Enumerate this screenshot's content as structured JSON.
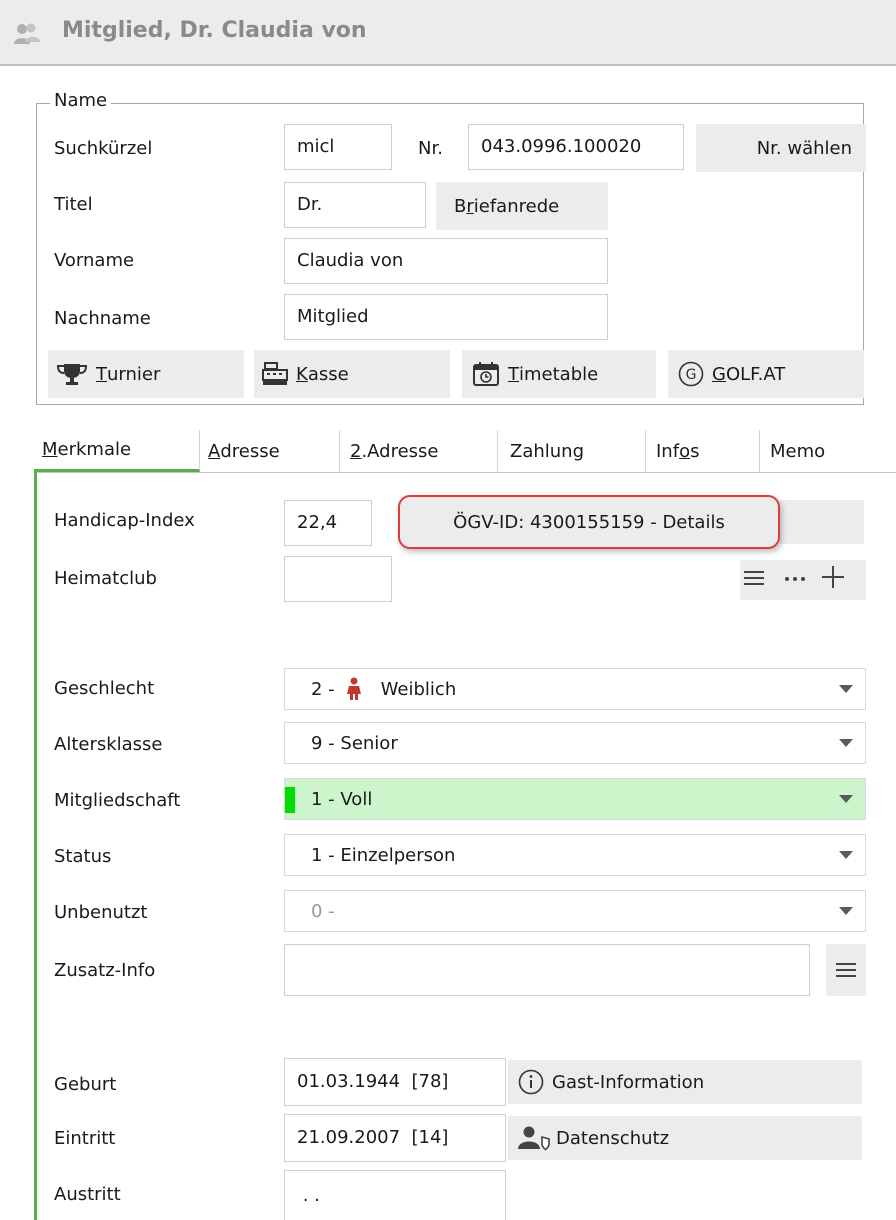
{
  "window": {
    "title": "Mitglied, Dr. Claudia von"
  },
  "name_group": {
    "legend": "Name",
    "suchkuerzel_label": "Suchkürzel",
    "suchkuerzel_value": "micl",
    "nr_label": "Nr.",
    "nr_value": "043.0996.100020",
    "nr_waehlen": "Nr. wählen",
    "titel_label": "Titel",
    "titel_value": "Dr.",
    "briefanrede_prefix": "B",
    "briefanrede_u": "r",
    "briefanrede_suffix": "iefanrede",
    "vorname_label": "Vorname",
    "vorname_value": "Claudia von",
    "nachname_label": "Nachname",
    "nachname_value": "Mitglied"
  },
  "toolbar": {
    "turnier_u": "T",
    "turnier_rest": "urnier",
    "kasse_u": "K",
    "kasse_rest": "asse",
    "timetable_u": "T",
    "timetable_rest": "imetable",
    "golf_u": "G",
    "golf_rest": "OLF.AT"
  },
  "tabs": {
    "merkmale_u": "M",
    "merkmale_rest": "erkmale",
    "adresse_u": "A",
    "adresse_rest": "dresse",
    "adresse2_u": "2",
    "adresse2_rest": ".Adresse",
    "zahlung": "Zahlung",
    "infos_pre": "Inf",
    "infos_u": "o",
    "infos_rest": "s",
    "memo": "Memo"
  },
  "merkmale": {
    "handicap_label": "Handicap-Index",
    "handicap_value": "22,4",
    "ogv_button": "ÖGV-ID: 4300155159 - Details",
    "heimatclub_label": "Heimatclub",
    "heimatclub_value": "",
    "geschlecht_label": "Geschlecht",
    "geschlecht_code": "2 -",
    "geschlecht_value": "Weiblich",
    "altersklasse_label": "Altersklasse",
    "altersklasse_value": "9 - Senior",
    "mitgliedschaft_label": "Mitgliedschaft",
    "mitgliedschaft_value": "1 - Voll",
    "status_label": "Status",
    "status_value": "1 - Einzelperson",
    "unbenutzt_label": "Unbenutzt",
    "unbenutzt_value": "0 -",
    "zusatz_label": "Zusatz-Info",
    "zusatz_value": "",
    "geburt_label": "Geburt",
    "geburt_value": "01.03.1944  [78]",
    "gast_info": "Gast-Information",
    "eintritt_label": "Eintritt",
    "eintritt_value": "21.09.2007  [14]",
    "datenschutz": "Datenschutz",
    "austritt_label": "Austritt",
    "austritt_value": " . ."
  },
  "colors": {
    "accent_green": "#55b14b",
    "mitgliedschaft_bg": "#ccf5cc",
    "mitgliedschaft_marker": "#00dd00",
    "highlight_red": "#e03b3b",
    "female_icon": "#c0392b"
  }
}
